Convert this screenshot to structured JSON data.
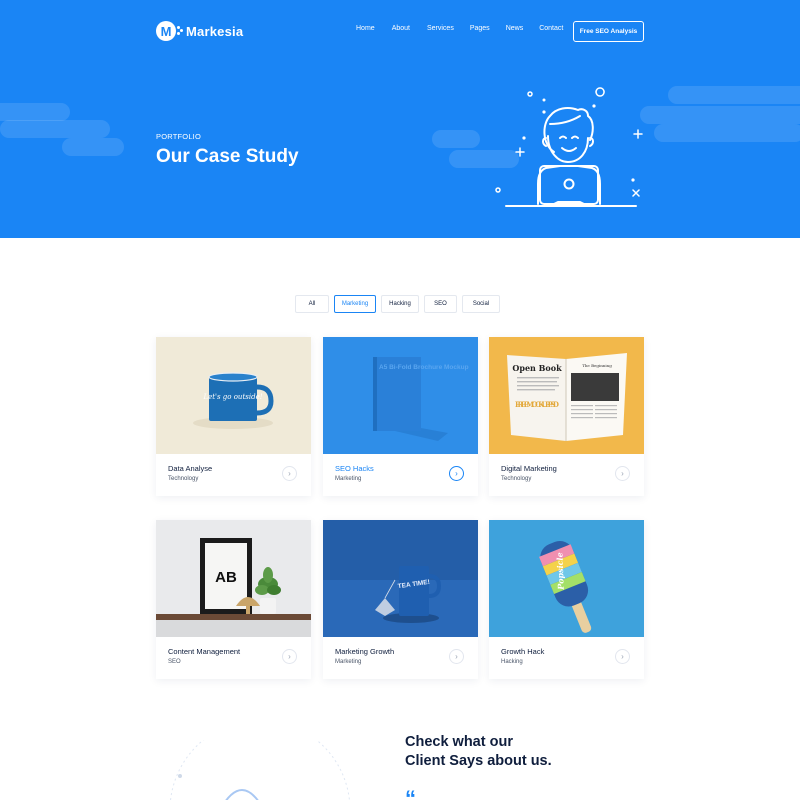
{
  "brand": {
    "name": "Markesia",
    "logo_letter": "M",
    "accent": "#1a85f5"
  },
  "nav": {
    "items": [
      "Home",
      "About",
      "Services",
      "Pages",
      "News",
      "Contact"
    ],
    "cta": "Free SEO Analysis"
  },
  "hero": {
    "eyebrow": "PORTFOLIO",
    "title": "Our Case Study",
    "illustration": "person-with-laptop-illustration"
  },
  "filters": [
    {
      "label": "All",
      "active": false
    },
    {
      "label": "Marketing",
      "active": true
    },
    {
      "label": "Hacking",
      "active": false
    },
    {
      "label": "SEO",
      "active": false
    },
    {
      "label": "Social",
      "active": false
    }
  ],
  "cards": [
    {
      "title": "Data Analyse",
      "category": "Technology",
      "image": "enamel-mug-photo",
      "mug_text": "Let's go outside!",
      "active": false
    },
    {
      "title": "SEO Hacks",
      "category": "Marketing",
      "image": "brochure-mockup-photo",
      "brochure_text": "A5 Bi-Fold Brochure Mockup",
      "active": true
    },
    {
      "title": "Digital Marketing",
      "category": "Technology",
      "image": "open-book-photo",
      "book_title": "Open Book",
      "book_subtitle": "FREE MOCKUP PSD",
      "page_title": "The Beginning",
      "active": false
    },
    {
      "title": "Content Management",
      "category": "SEO",
      "image": "frame-and-lamp-photo",
      "frame_text": "AB",
      "active": false
    },
    {
      "title": "Marketing Growth",
      "category": "Marketing",
      "image": "tea-mug-photo",
      "mug_text": "TEA TIME!",
      "active": false
    },
    {
      "title": "Growth Hack",
      "category": "Hacking",
      "image": "popsicle-photo",
      "popsicle_text": "Popsicle",
      "active": false
    }
  ],
  "testimonial": {
    "title_line1": "Check what our",
    "title_line2": "Client Says about us.",
    "quote_mark": "“"
  },
  "icons": {
    "card_arrow": "chevron-right-icon",
    "quote": "quote-icon"
  }
}
